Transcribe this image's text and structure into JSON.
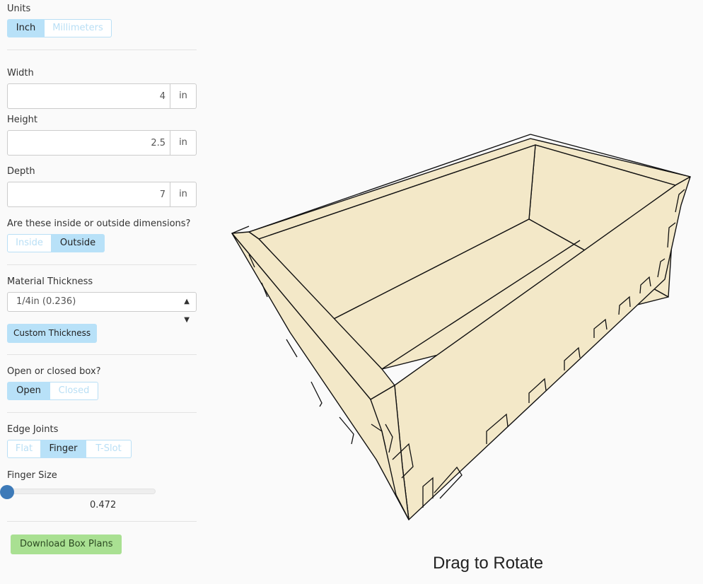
{
  "units": {
    "label": "Units",
    "options": [
      "Inch",
      "Millimeters"
    ],
    "selected": "Inch"
  },
  "width": {
    "label": "Width",
    "value": "4",
    "unit": "in"
  },
  "height": {
    "label": "Height",
    "value": "2.5",
    "unit": "in"
  },
  "depth": {
    "label": "Depth",
    "value": "7",
    "unit": "in"
  },
  "dimension_type": {
    "label": "Are these inside or outside dimensions?",
    "options": [
      "Inside",
      "Outside"
    ],
    "selected": "Outside"
  },
  "material": {
    "label": "Material Thickness",
    "selected": "1/4in (0.236)",
    "custom_button": "Custom Thickness"
  },
  "box_type": {
    "label": "Open or closed box?",
    "options": [
      "Open",
      "Closed"
    ],
    "selected": "Open"
  },
  "edge_joints": {
    "label": "Edge Joints",
    "options": [
      "Flat",
      "Finger",
      "T-Slot"
    ],
    "selected": "Finger"
  },
  "finger_size": {
    "label": "Finger Size",
    "value": "0.472",
    "slider_fraction": 0
  },
  "download_button": "Download Box Plans",
  "viewport": {
    "caption": "Drag to Rotate",
    "fill_color": "#f3e8c8",
    "stroke_color": "#111111"
  },
  "colors": {
    "accent": "#b8e1f8",
    "download": "#a9e092",
    "thumb": "#3d7ab8"
  }
}
